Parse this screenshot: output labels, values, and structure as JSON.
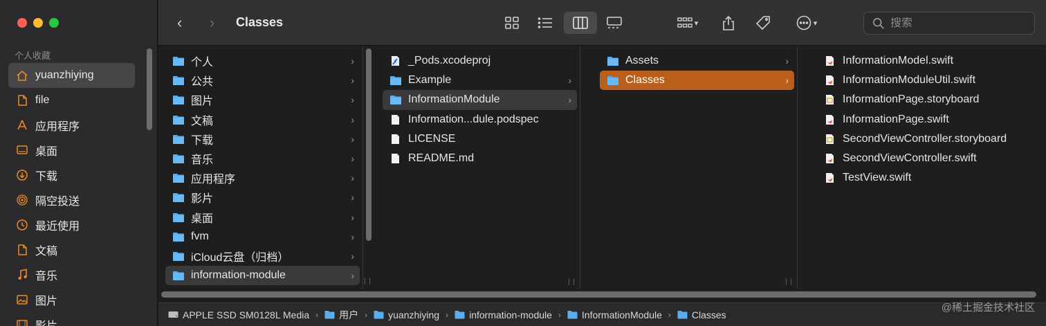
{
  "window": {
    "title": "Classes"
  },
  "sidebar": {
    "section_title": "个人收藏",
    "items": [
      {
        "label": "yuanzhiying",
        "icon": "home-icon",
        "selected": true
      },
      {
        "label": "file",
        "icon": "document-icon"
      },
      {
        "label": "应用程序",
        "icon": "applications-icon"
      },
      {
        "label": "桌面",
        "icon": "desktop-icon"
      },
      {
        "label": "下载",
        "icon": "download-icon"
      },
      {
        "label": "隔空投送",
        "icon": "airdrop-icon"
      },
      {
        "label": "最近使用",
        "icon": "clock-icon"
      },
      {
        "label": "文稿",
        "icon": "document-icon"
      },
      {
        "label": "音乐",
        "icon": "music-icon"
      },
      {
        "label": "图片",
        "icon": "photo-icon"
      },
      {
        "label": "影片",
        "icon": "film-icon"
      }
    ]
  },
  "toolbar": {
    "back_glyph": "‹",
    "forward_glyph": "›",
    "search_placeholder": "搜索"
  },
  "columns": [
    {
      "items": [
        {
          "label": "个人",
          "type": "folder",
          "chevron": true
        },
        {
          "label": "公共",
          "type": "folder",
          "chevron": true
        },
        {
          "label": "图片",
          "type": "folder",
          "chevron": true
        },
        {
          "label": "文稿",
          "type": "folder",
          "chevron": true
        },
        {
          "label": "下载",
          "type": "folder",
          "chevron": true
        },
        {
          "label": "音乐",
          "type": "folder",
          "chevron": true
        },
        {
          "label": "应用程序",
          "type": "folder",
          "chevron": true
        },
        {
          "label": "影片",
          "type": "folder",
          "chevron": true
        },
        {
          "label": "桌面",
          "type": "folder",
          "chevron": true
        },
        {
          "label": "fvm",
          "type": "folder",
          "chevron": true
        },
        {
          "label": "iCloud云盘（归档）",
          "type": "folder",
          "chevron": true
        },
        {
          "label": "information-module",
          "type": "folder",
          "chevron": true,
          "highlight": "gray"
        }
      ]
    },
    {
      "items": [
        {
          "label": "_Pods.xcodeproj",
          "type": "xcodeproj"
        },
        {
          "label": "Example",
          "type": "folder",
          "chevron": true
        },
        {
          "label": "InformationModule",
          "type": "folder",
          "chevron": true,
          "highlight": "gray"
        },
        {
          "label": "Information...dule.podspec",
          "type": "file"
        },
        {
          "label": "LICENSE",
          "type": "file"
        },
        {
          "label": "README.md",
          "type": "file"
        }
      ]
    },
    {
      "items": [
        {
          "label": "Assets",
          "type": "folder",
          "chevron": true
        },
        {
          "label": "Classes",
          "type": "folder",
          "chevron": true,
          "highlight": "orange"
        }
      ]
    },
    {
      "items": [
        {
          "label": "InformationModel.swift",
          "type": "swift"
        },
        {
          "label": "InformationModuleUtil.swift",
          "type": "swift"
        },
        {
          "label": "InformationPage.storyboard",
          "type": "storyboard"
        },
        {
          "label": "InformationPage.swift",
          "type": "swift"
        },
        {
          "label": "SecondViewController.storyboard",
          "type": "storyboard"
        },
        {
          "label": "SecondViewController.swift",
          "type": "swift"
        },
        {
          "label": "TestView.swift",
          "type": "swift"
        }
      ]
    }
  ],
  "pathbar": [
    {
      "label": "APPLE SSD SM0128L Media",
      "icon": "disk-icon"
    },
    {
      "label": "用户",
      "icon": "folder-icon"
    },
    {
      "label": "yuanzhiying",
      "icon": "home-folder-icon"
    },
    {
      "label": "information-module",
      "icon": "folder-icon"
    },
    {
      "label": "InformationModule",
      "icon": "folder-icon"
    },
    {
      "label": "Classes",
      "icon": "folder-icon"
    }
  ],
  "watermark": "@稀土掘金技术社区",
  "colors": {
    "accent": "#f08a24",
    "selection_orange": "#b95f1b",
    "folder_blue": "#5aaef0"
  }
}
